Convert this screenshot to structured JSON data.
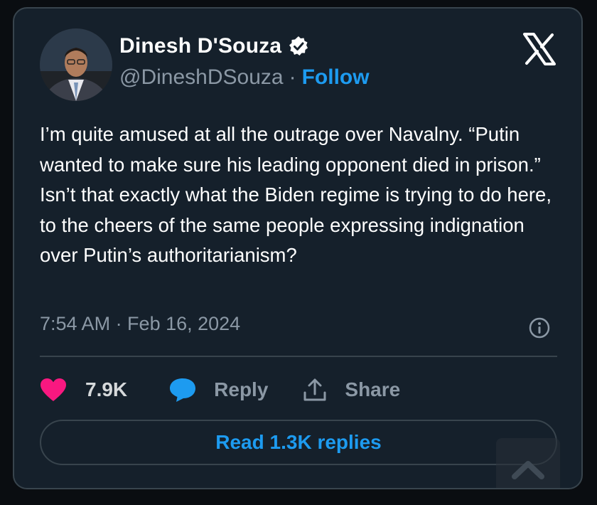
{
  "author": {
    "display_name": "Dinesh D'Souza",
    "handle": "@DineshDSouza",
    "separator": "·",
    "follow_label": "Follow",
    "verified": true,
    "avatar_icon": "profile-photo"
  },
  "tweet": {
    "text": "I’m quite amused at all the outrage over Navalny. “Putin wanted to make sure his leading opponent died in prison.” Isn’t that exactly what the Biden regime is trying to do here, to the cheers of the same people expressing indignation over Putin’s authoritarianism?",
    "timestamp": "7:54 AM · Feb 16, 2024"
  },
  "actions": {
    "likes": "7.9K",
    "reply_label": "Reply",
    "share_label": "Share"
  },
  "footer": {
    "read_replies_label": "Read 1.3K replies"
  },
  "colors": {
    "background": "#15202b",
    "border": "#38444d",
    "accent": "#1d9bf0",
    "like": "#f91880",
    "muted": "#8b98a5"
  }
}
